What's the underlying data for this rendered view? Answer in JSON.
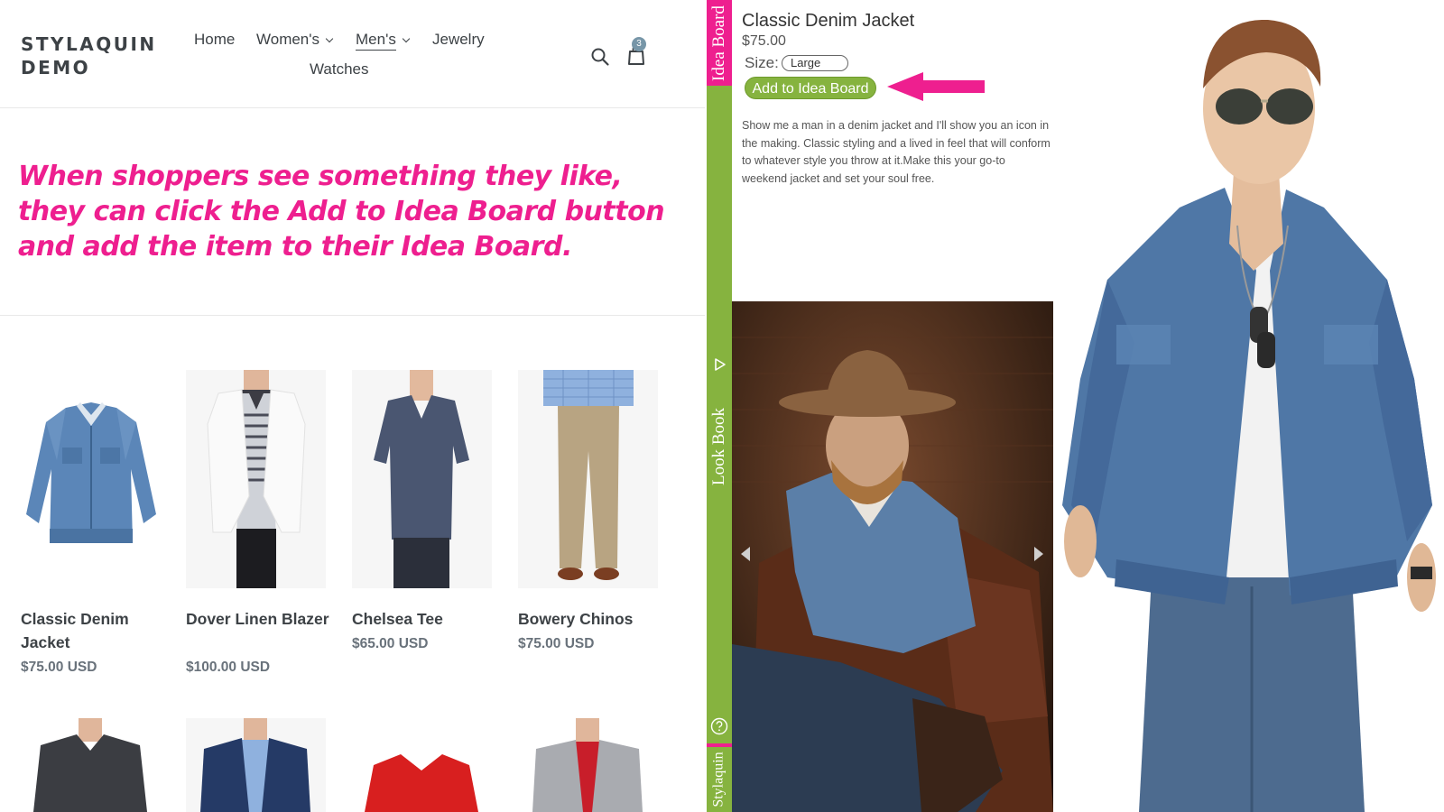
{
  "store": {
    "logo_line1": "STYLAQUIN",
    "logo_line2": "DEMO",
    "nav": [
      {
        "label": "Home"
      },
      {
        "label": "Women's"
      },
      {
        "label": "Men's"
      },
      {
        "label": "Jewelry"
      },
      {
        "label": "Watches"
      }
    ],
    "cart_count": "3",
    "icons": {
      "search": "search-icon",
      "cart": "shopping-bag-icon"
    },
    "promo_text": "When shoppers see something they like, they can click the Add to Idea Board button and add the item to their Idea Board.",
    "products": [
      {
        "name": "Classic Denim Jacket",
        "price": "$75.00 USD"
      },
      {
        "name": "Dover Linen Blazer",
        "price": "$100.00 USD"
      },
      {
        "name": "Chelsea Tee",
        "price": "$65.00 USD"
      },
      {
        "name": "Bowery Chinos",
        "price": "$75.00 USD"
      }
    ]
  },
  "sidebar": {
    "idea_board_label": "Idea Board",
    "look_book_label": "Look Book",
    "brand_label": "Stylaquin",
    "play_icon": "play-icon",
    "help_icon": "help-icon"
  },
  "board": {
    "title": "Classic Denim Jacket",
    "price": "$75.00",
    "size_label": "Size:",
    "size_value": "Large",
    "add_button": "Add to Idea Board",
    "description": "Show me a man in a denim jacket and I'll show you an icon in the making. Classic styling and a lived in feel that will conform to whatever style you throw at it.Make this your go-to weekend jacket and set your soul free."
  },
  "colors": {
    "accent_pink": "#ee1f8f",
    "accent_green": "#86b33f",
    "text_dark": "#3d4246",
    "cart_badge": "#7796a8"
  }
}
